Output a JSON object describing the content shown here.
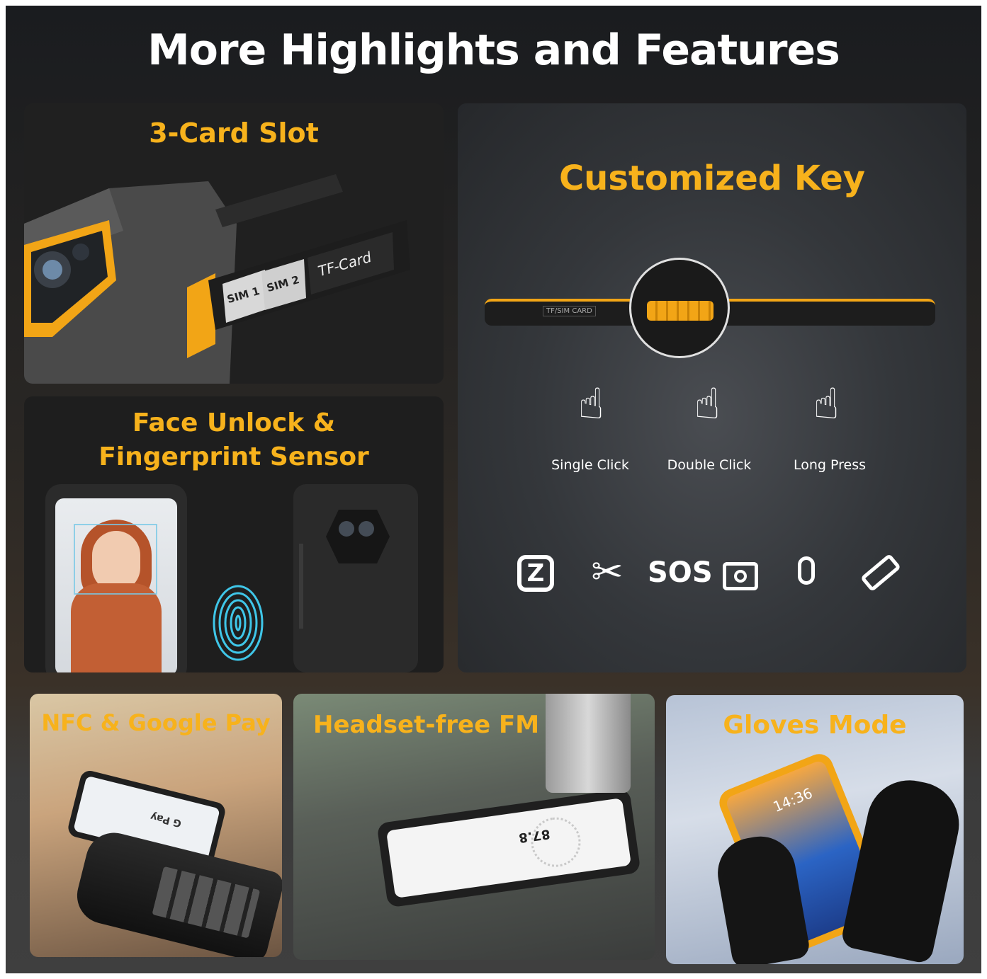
{
  "headline": "More Highlights and Features",
  "panels": {
    "card_slot": {
      "title": "3-Card Slot",
      "slot_labels": [
        "SIM 1",
        "SIM 2",
        "TF-Card"
      ]
    },
    "face": {
      "title_line1": "Face Unlock &",
      "title_line2": "Fingerprint Sensor"
    },
    "key": {
      "title": "Customized Key",
      "device_label": "TF/SIM CARD",
      "gestures": [
        "Single Click",
        "Double Click",
        "Long Press"
      ],
      "functions": [
        "zello-icon",
        "scissors-icon",
        "sos-icon",
        "camera-icon",
        "microphone-icon",
        "flashlight-icon"
      ],
      "sos_text": "SOS"
    },
    "nfc": {
      "title": "NFC & Google Pay",
      "screen_text": "G Pay"
    },
    "fm": {
      "title": "Headset-free FM",
      "freq": "87.8"
    },
    "gloves": {
      "title": "Gloves Mode",
      "time": "14:36"
    }
  },
  "colors": {
    "accent": "#f7b21c",
    "fingerprint": "#3fc6e8"
  }
}
